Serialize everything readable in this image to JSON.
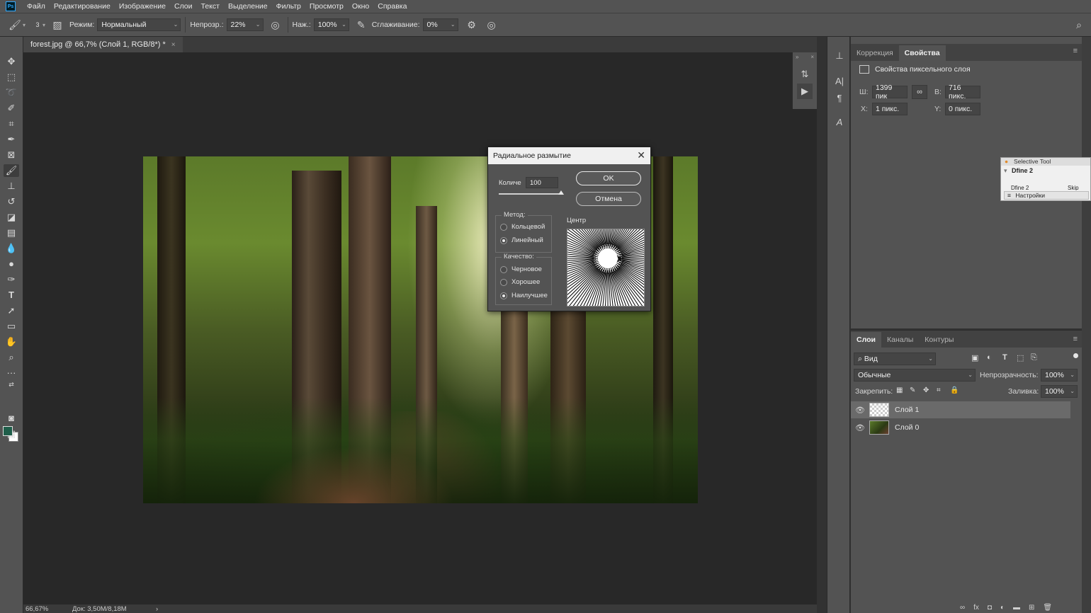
{
  "menubar": {
    "logo": "Ps",
    "items": [
      "Файл",
      "Редактирование",
      "Изображение",
      "Слои",
      "Текст",
      "Выделение",
      "Фильтр",
      "Просмотр",
      "Окно",
      "Справка"
    ]
  },
  "options": {
    "brush_size": "3",
    "mode_label": "Режим:",
    "mode_value": "Нормальный",
    "opacity_label": "Непрозр.:",
    "opacity_value": "22%",
    "pressure_label": "Наж.:",
    "pressure_value": "100%",
    "smoothing_label": "Сглаживание:",
    "smoothing_value": "0%"
  },
  "document": {
    "tab_title": "forest.jpg @ 66,7% (Слой 1, RGB/8*) *",
    "close_glyph": "×"
  },
  "statusbar": {
    "zoom": "66,67%",
    "doc_info": "Док: 3,50M/8,18M",
    "arrow": "›"
  },
  "properties_panel": {
    "tabs": [
      "Коррекция",
      "Свойства"
    ],
    "active_tab": "Свойства",
    "section_title": "Свойства пиксельного слоя",
    "w_label": "Ш:",
    "w_value": "1399 пик",
    "h_label": "В:",
    "h_value": "716 пикс.",
    "x_label": "X:",
    "x_value": "1 пикс.",
    "y_label": "Y:",
    "y_value": "0 пикс."
  },
  "selective_tool": {
    "title": "Selective Tool",
    "item": "Dfine 2",
    "sub_left": "Dfine 2",
    "sub_right": "Skip",
    "settings": "Настройки"
  },
  "layers_panel": {
    "tabs": [
      "Слои",
      "Каналы",
      "Контуры"
    ],
    "active_tab": "Слои",
    "filter_value": "Вид",
    "blend_mode": "Обычные",
    "opacity_label": "Непрозрачность:",
    "opacity_value": "100%",
    "lock_label": "Закрепить:",
    "fill_label": "Заливка:",
    "fill_value": "100%",
    "layers": [
      {
        "name": "Слой 1",
        "selected": true
      },
      {
        "name": "Слой 0",
        "selected": false
      }
    ]
  },
  "dialog": {
    "title": "Радиальное размытие",
    "amount_label": "Количе",
    "amount_value": "100",
    "amount_fraction": 1.0,
    "ok_label": "OK",
    "cancel_label": "Отмена",
    "method_title": "Метод:",
    "method_options": [
      "Кольцевой",
      "Линейный"
    ],
    "method_selected": "Линейный",
    "quality_title": "Качество:",
    "quality_options": [
      "Черновое",
      "Хорошее",
      "Наилучшее"
    ],
    "quality_selected": "Наилучшее",
    "center_label": "Центр"
  },
  "colors": {
    "foreground": "#1f5e4a",
    "background": "#ffffff",
    "accent": "#31a8ff"
  }
}
